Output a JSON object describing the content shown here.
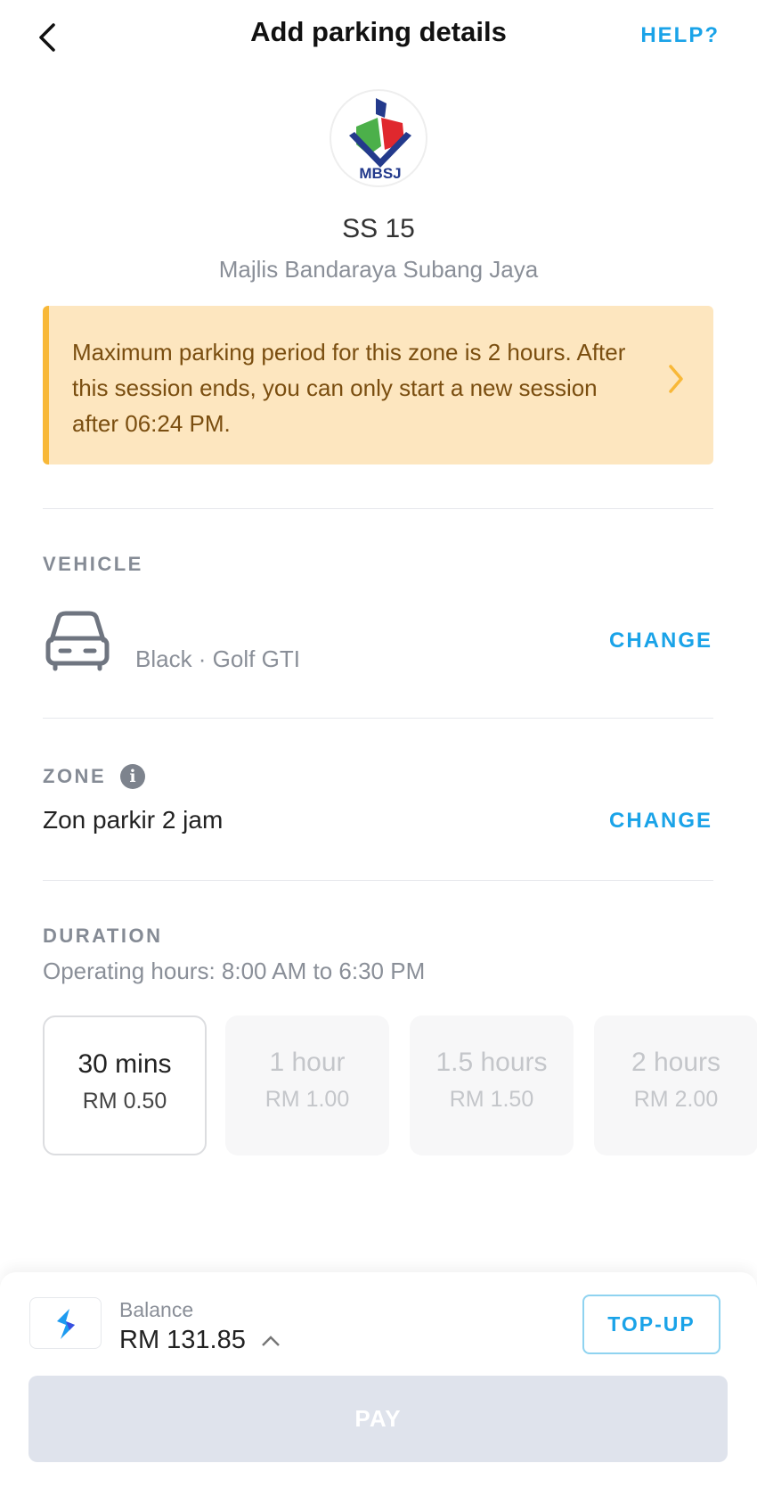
{
  "header": {
    "title": "Add parking details",
    "help_label": "HELP?"
  },
  "location": {
    "logo_text": "MBSJ",
    "name": "SS 15",
    "agency": "Majlis Bandaraya Subang Jaya"
  },
  "notice": {
    "text": "Maximum parking period for this zone is 2 hours. After this session ends, you can only start a new session after 06:24 PM.",
    "color": "#fde6bf"
  },
  "vehicle": {
    "label": "VEHICLE",
    "value": "Black · Golf GTI",
    "change_label": "CHANGE"
  },
  "zone": {
    "label": "ZONE",
    "value": "Zon parkir 2 jam",
    "change_label": "CHANGE"
  },
  "duration": {
    "label": "DURATION",
    "operating_hours": "Operating hours: 8:00 AM to 6:30 PM",
    "options": [
      {
        "time": "30 mins",
        "price": "RM 0.50",
        "selected": true
      },
      {
        "time": "1 hour",
        "price": "RM 1.00",
        "selected": false
      },
      {
        "time": "1.5 hours",
        "price": "RM 1.50",
        "selected": false
      },
      {
        "time": "2 hours",
        "price": "RM 2.00",
        "selected": false
      }
    ]
  },
  "wallet": {
    "balance_label": "Balance",
    "balance": "RM 131.85",
    "topup_label": "TOP-UP"
  },
  "pay_label": "PAY",
  "accent": "#1aa3e8"
}
